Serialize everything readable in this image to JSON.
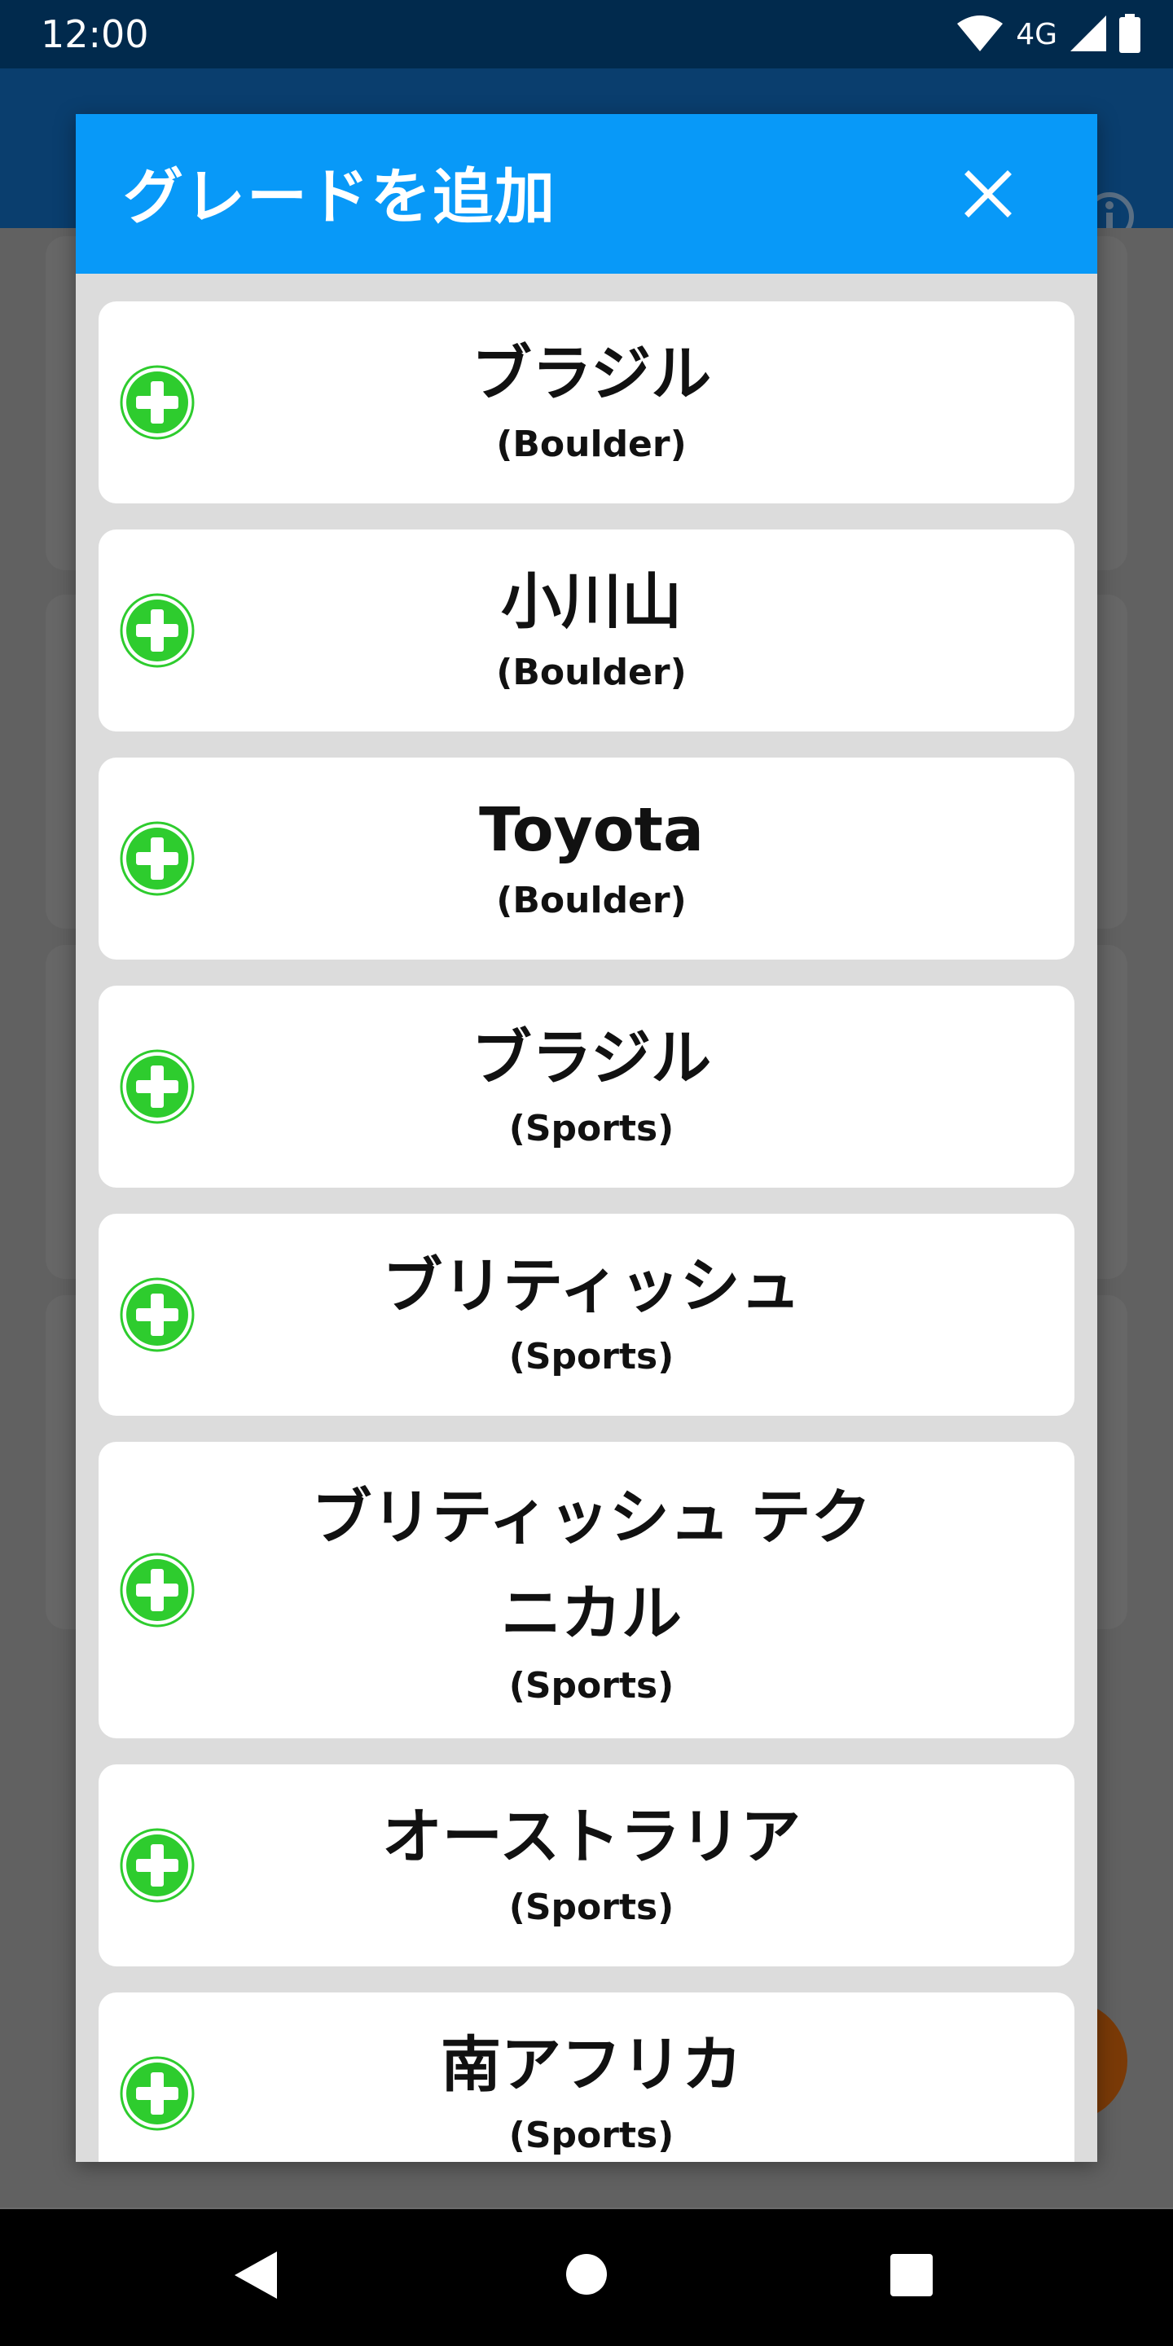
{
  "status_bar": {
    "time": "12:00",
    "network": "4G",
    "icons": [
      "wifi-icon",
      "signal-icon",
      "battery-icon"
    ]
  },
  "dialog": {
    "title": "グレードを追加",
    "close_icon": "close-icon",
    "header_color": "#0899f8",
    "add_icon": "plus-circle-icon",
    "add_icon_color": "#2ecc2e",
    "items": [
      {
        "name": "ブラジル",
        "type": "(Boulder)"
      },
      {
        "name": "小川山",
        "type": "(Boulder)"
      },
      {
        "name": "Toyota",
        "type": "(Boulder)"
      },
      {
        "name": "ブラジル",
        "type": "(Sports)"
      },
      {
        "name": "ブリティッシュ",
        "type": "(Sports)"
      },
      {
        "name": "ブリティッシュ テク\nニカル",
        "type": "(Sports)"
      },
      {
        "name": "オーストラリア",
        "type": "(Sports)"
      },
      {
        "name": "南アフリカ",
        "type": "(Sports)"
      }
    ]
  },
  "app_bar": {
    "info_icon": "info-icon"
  },
  "nav_bar": {
    "buttons": [
      "back-icon",
      "home-icon",
      "recents-icon"
    ]
  }
}
